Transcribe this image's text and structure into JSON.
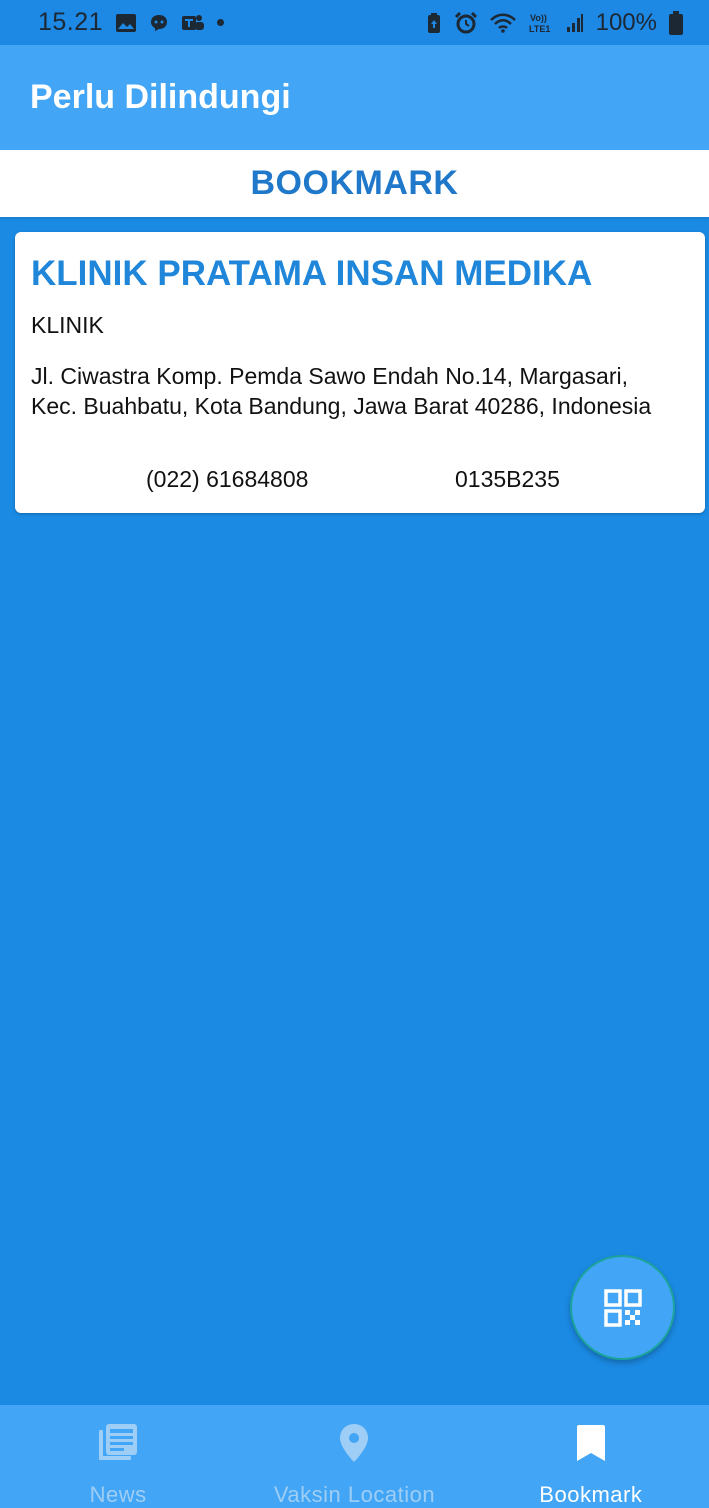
{
  "status_bar": {
    "time": "15.21",
    "battery": "100%",
    "icons_left": [
      "gallery-icon",
      "chat-bubble-icon",
      "teams-icon",
      "notification-dot"
    ],
    "icons_right": [
      "battery-saver-icon",
      "alarm-icon",
      "wifi-icon",
      "volte-icon",
      "signal-icon",
      "battery-icon"
    ]
  },
  "app_bar": {
    "title": "Perlu Dilindungi"
  },
  "section": {
    "title": "BOOKMARK"
  },
  "bookmarks": [
    {
      "name": "KLINIK PRATAMA INSAN MEDIKA",
      "type": "KLINIK",
      "address": "Jl. Ciwastra Komp. Pemda Sawo Endah No.14, Margasari, Kec. Buahbatu, Kota Bandung, Jawa Barat 40286, Indonesia",
      "phone": "(022) 61684808",
      "code": "0135B235"
    }
  ],
  "fab": {
    "icon": "qr-code-icon"
  },
  "bottom_nav": {
    "items": [
      {
        "label": "News",
        "icon": "news-icon",
        "active": false
      },
      {
        "label": "Vaksin Location",
        "icon": "location-pin-icon",
        "active": false
      },
      {
        "label": "Bookmark",
        "icon": "bookmark-icon",
        "active": true
      }
    ]
  },
  "colors": {
    "background": "#1b8ae3",
    "app_bar": "#42a5f5",
    "accent_text": "#1f86d9",
    "nav_inactive": "#9ecef5",
    "nav_active": "#ffffff"
  }
}
